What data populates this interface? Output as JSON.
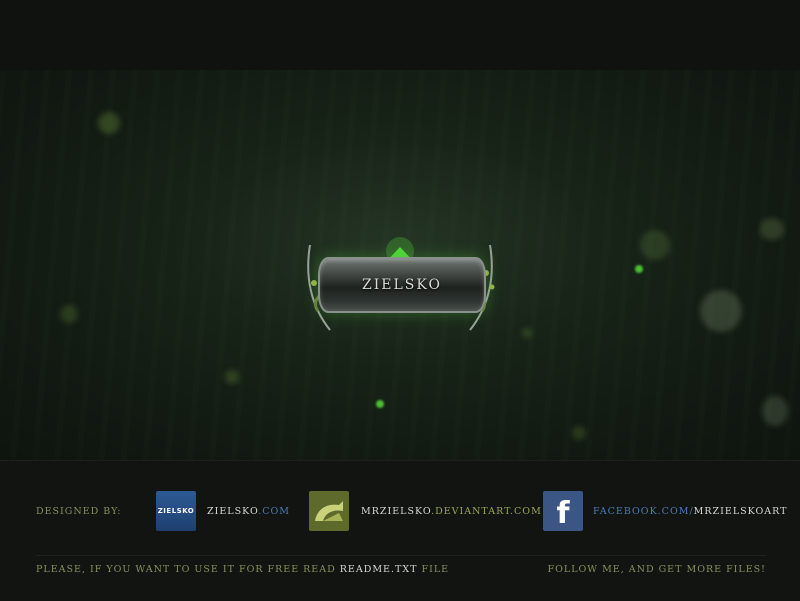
{
  "emblem": {
    "title": "ZIELSKO"
  },
  "footer": {
    "designed_by": "DESIGNED BY:",
    "zielsko_logo_text": "ZIELSKO",
    "zielsko_link": {
      "name": "ZIELSKO",
      "domain": ".COM"
    },
    "deviantart_link": {
      "name": "MRZIELSKO",
      "domain": ".DEVIANTART.COM"
    },
    "facebook_logo_text": "f",
    "facebook_link": {
      "prefix": "FACEBOOK.COM/",
      "name": "MRZIELSKOART"
    },
    "note_before": "PLEASE, IF YOU WANT TO USE IT FOR FREE READ",
    "note_file": "README.TXT",
    "note_after": "FILE",
    "follow_text": "FOLLOW ME, AND GET MORE FILES!"
  },
  "colors": {
    "background": "#0c0f0c",
    "hero": "#182418",
    "accent_green": "#6ee04a",
    "olive_text": "#8b8f60",
    "link_blue": "#4f7bb2",
    "facebook_blue": "#3b5585",
    "deviantart_olive": "#5e6a2c"
  },
  "icons": {
    "zielsko": "zielsko-logo-icon",
    "deviantart": "deviantart-icon",
    "facebook": "facebook-icon"
  }
}
